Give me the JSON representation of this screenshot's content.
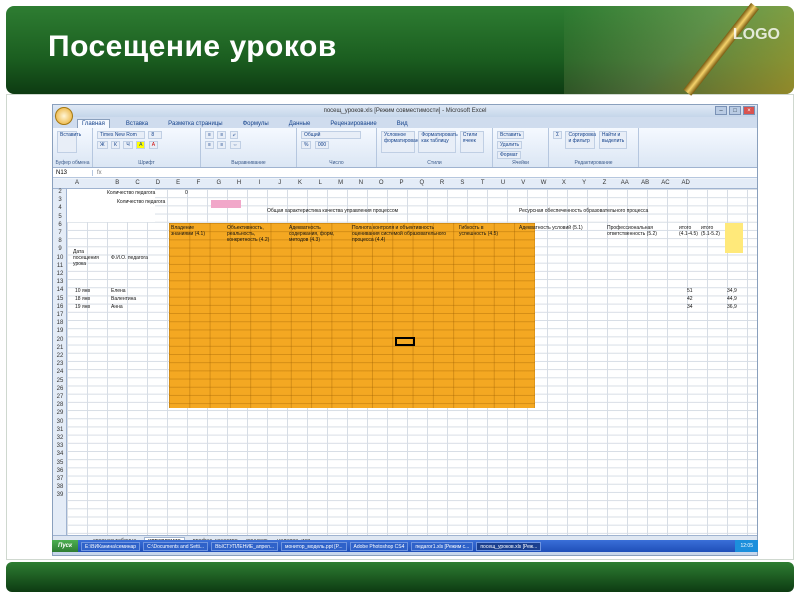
{
  "slide": {
    "title": "Посещение уроков",
    "logo": "LOGO"
  },
  "excel": {
    "window_title": "посещ_уроков.xls [Режим совместимости] - Microsoft Excel",
    "tabs": [
      "Главная",
      "Вставка",
      "Разметка страницы",
      "Формулы",
      "Данные",
      "Рецензирование",
      "Вид"
    ],
    "ribbon_groups": {
      "clipboard": "Буфер обмена",
      "font": "Шрифт",
      "alignment": "Выравнивание",
      "number": "Число",
      "styles": "Стили",
      "cells": "Ячейки",
      "editing": "Редактирование"
    },
    "ribbon_buttons": {
      "paste": "Вставить",
      "font_name": "Times New Rom",
      "font_size": "8",
      "number_format": "Общий",
      "conditional": "Условное форматирование",
      "format_table": "Форматировать как таблицу",
      "cell_styles": "Стили ячеек",
      "insert": "Вставить",
      "delete": "Удалить",
      "format": "Формат",
      "sort": "Сортировка и фильтр",
      "find": "Найти и выделить"
    },
    "name_box": "N13",
    "columns": [
      "A",
      "B",
      "C",
      "D",
      "E",
      "F",
      "G",
      "H",
      "I",
      "J",
      "K",
      "L",
      "M",
      "N",
      "O",
      "P",
      "Q",
      "R",
      "S",
      "T",
      "U",
      "V",
      "W",
      "X",
      "Y",
      "Z",
      "AA",
      "AB",
      "AC",
      "AD"
    ],
    "rows": [
      "2",
      "3",
      "4",
      "5",
      "6",
      "7",
      "8",
      "9",
      "10",
      "11",
      "12",
      "13",
      "14",
      "15",
      "16",
      "17",
      "18",
      "19",
      "20",
      "21",
      "22",
      "23",
      "24",
      "25",
      "26",
      "27",
      "28",
      "29",
      "30",
      "31",
      "32",
      "33",
      "34",
      "35",
      "36",
      "37",
      "38",
      "39"
    ],
    "cells": {
      "teacher_count": "Количество педагога",
      "teacher_count_val": "0",
      "teacher_count2": "Количество педагога",
      "header_orange": "Общая характеристика качества управления процессом",
      "header_resource": "Ресурсная обеспеченность образовательного процесса",
      "date_header": "Дата посещения урока",
      "fio_header": "Ф.И.О. педагога",
      "sub1": "Владение знаниями (4.1)",
      "sub2": "Объективность, реальность, конкретность (4.2)",
      "sub3": "Адекватность содержания, форм, методов (4.3)",
      "sub4": "Полнота контроля и объективность оценивания системой образовательного процесса (4.4)",
      "sub5": "Гибкость в успешность (4.5)",
      "res1": "Адекватность условий (5.1)",
      "res2": "Профессиональная ответственность (5.2)",
      "total1": "итого (4.1-4.5)",
      "total2": "итого (5.1-5.2)",
      "teacher1": "Елена",
      "teacher2": "Валентина",
      "teacher3": "Анна",
      "date1": "10 янв",
      "date2": "18 янв",
      "date3": "19 янв",
      "sum1": "51",
      "sum2": "42",
      "sum3": "34",
      "pct1": "34,9",
      "pct2": "44,9",
      "pct3": "36,9"
    },
    "sheet_tabs": [
      "сводная таблица",
      "управление",
      "профес_качество",
      "личность",
      "целевое_исп"
    ],
    "active_sheet": "управление",
    "status": "Готово"
  },
  "taskbar": {
    "start": "Пуск",
    "items": [
      "E:\\ВИКанина\\семинар",
      "C:\\Documents and Setti...",
      "ВЫСТУПЛЕНИЕ_апрел...",
      "монитор_модель.ppt [P...",
      "Adobe Photoshop CS4",
      "педагог1.xls [Режим с...",
      "посещ_уроков.xls [Реж..."
    ],
    "clock": "12:05"
  }
}
